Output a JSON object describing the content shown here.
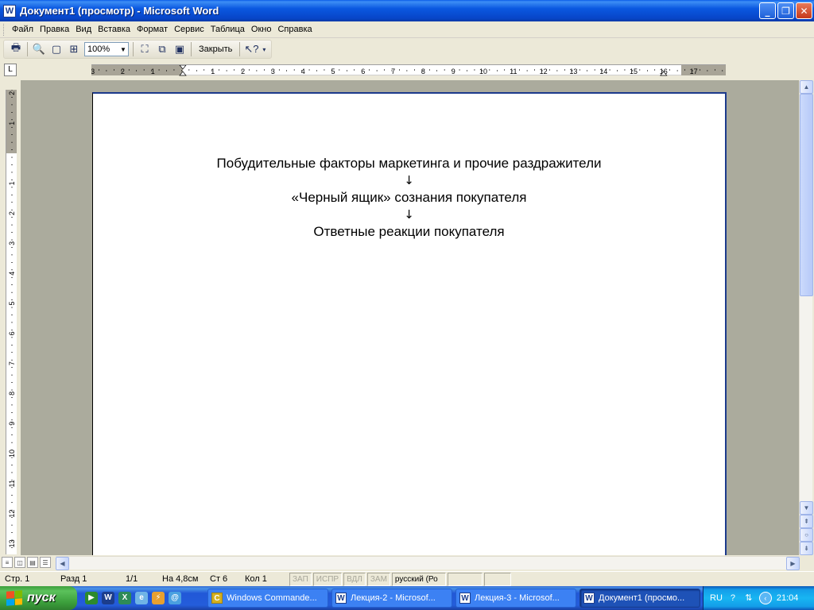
{
  "window": {
    "title": "Документ1 (просмотр) - Microsoft Word",
    "app_icon_letter": "W"
  },
  "menu": [
    "Файл",
    "Правка",
    "Вид",
    "Вставка",
    "Формат",
    "Сервис",
    "Таблица",
    "Окно",
    "Справка"
  ],
  "toolbar": {
    "zoom_value": "100%",
    "close_label": "Закрыть"
  },
  "ruler": {
    "horizontal_labels": [
      "3",
      "2",
      "1",
      "1",
      "2",
      "3",
      "4",
      "5",
      "6",
      "7",
      "8",
      "9",
      "10",
      "11",
      "12",
      "13",
      "14",
      "15",
      "16",
      "17"
    ],
    "vertical_labels": [
      "2",
      "1",
      "1",
      "2",
      "3",
      "4",
      "5",
      "6",
      "7",
      "8",
      "9",
      "10",
      "11",
      "12",
      "13"
    ]
  },
  "document": {
    "line1": "Побудительные факторы маркетинга и прочие раздражители",
    "arrow1": "↓",
    "line2": "«Черный ящик» сознания покупателя",
    "arrow2": "↓",
    "line3": "Ответные реакции покупателя"
  },
  "status": {
    "page": "Стр. 1",
    "section": "Разд 1",
    "pages": "1/1",
    "position": "На 4,8см",
    "line": "Ст 6",
    "column": "Кол 1",
    "rec": "ЗАП",
    "trk": "ИСПР",
    "ext": "ВДЛ",
    "ovr": "ЗАМ",
    "language": "русский (Ро"
  },
  "taskbar": {
    "start_label": "пуск",
    "tasks": [
      {
        "label": "Windows Commande...",
        "active": false
      },
      {
        "label": "Лекция-2 - Microsof...",
        "active": false
      },
      {
        "label": "Лекция-3 - Microsof...",
        "active": false
      },
      {
        "label": "Документ1 (просмо...",
        "active": true
      }
    ],
    "language": "RU",
    "clock": "21:04"
  }
}
